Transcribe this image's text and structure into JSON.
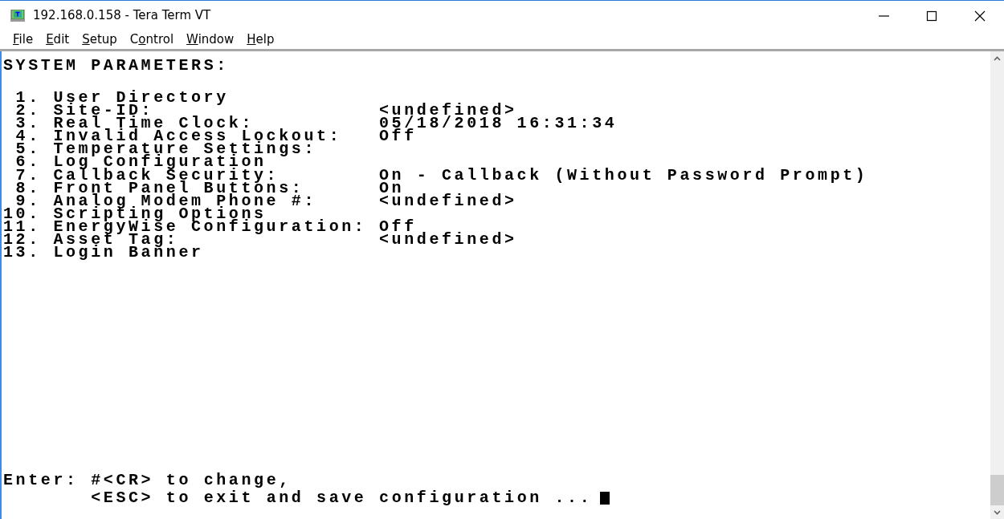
{
  "window": {
    "title": "192.168.0.158 - Tera Term VT"
  },
  "menu": [
    {
      "key": "F",
      "post": "ile"
    },
    {
      "key": "E",
      "post": "dit"
    },
    {
      "key": "S",
      "post": "etup"
    },
    {
      "pre": "C",
      "key": "o",
      "post": "ntrol"
    },
    {
      "key": "W",
      "post": "indow"
    },
    {
      "key": "H",
      "post": "elp"
    }
  ],
  "terminal": {
    "header": "SYSTEM PARAMETERS:",
    "items": [
      {
        "number": "1.",
        "label": "User Directory"
      },
      {
        "number": "2.",
        "label": "Site-ID:",
        "value": "<undefined>"
      },
      {
        "number": "3.",
        "label": "Real Time Clock:",
        "value": "05/18/2018 16:31:34"
      },
      {
        "number": "4.",
        "label": "Invalid Access Lockout:",
        "value": "Off"
      },
      {
        "number": "5.",
        "label": "Temperature Settings:"
      },
      {
        "number": "6.",
        "label": "Log Configuration"
      },
      {
        "number": "7.",
        "label": "Callback Security:",
        "value": "On - Callback (Without Password Prompt)"
      },
      {
        "number": "8.",
        "label": "Front Panel Buttons:",
        "value": "On"
      },
      {
        "number": "9.",
        "label": "Analog Modem Phone #:",
        "value": "<undefined>"
      },
      {
        "number": "10.",
        "label": "Scripting Options"
      },
      {
        "number": "11.",
        "label": "EnergyWise Configuration:",
        "value": "Off"
      },
      {
        "number": "12.",
        "label": "Asset Tag:",
        "value": "<undefined>"
      },
      {
        "number": "13.",
        "label": "Login Banner"
      }
    ],
    "prompt": [
      "Enter: #<CR> to change,",
      "       <ESC> to exit and save configuration ..."
    ]
  }
}
